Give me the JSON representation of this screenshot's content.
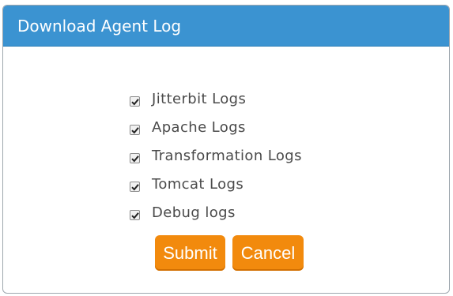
{
  "dialog": {
    "title": "Download Agent Log"
  },
  "options": [
    {
      "label": "Jitterbit Logs",
      "checked": true
    },
    {
      "label": "Apache Logs",
      "checked": true
    },
    {
      "label": "Transformation Logs",
      "checked": true
    },
    {
      "label": "Tomcat Logs",
      "checked": true
    },
    {
      "label": "Debug logs",
      "checked": true
    }
  ],
  "buttons": {
    "submit_label": "Submit",
    "cancel_label": "Cancel"
  },
  "colors": {
    "titlebar": "#3b93d1",
    "button": "#f28a0d"
  }
}
